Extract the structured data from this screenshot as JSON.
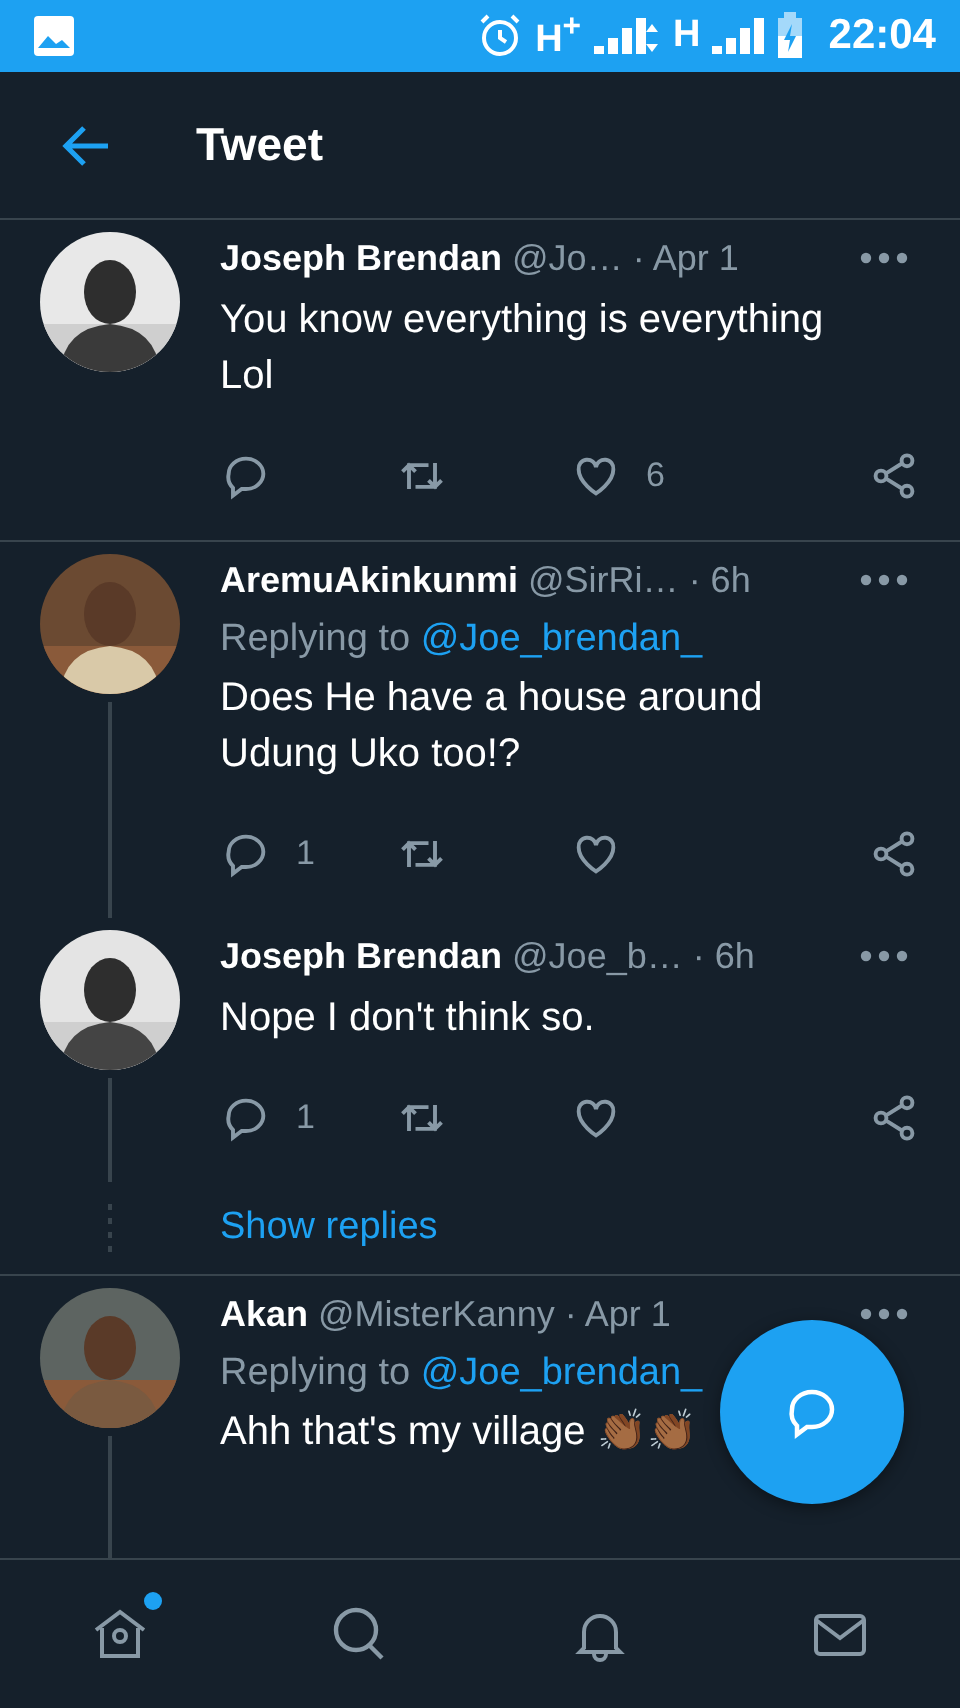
{
  "status_bar": {
    "network_1": "H$^{+}$",
    "network_2": "H",
    "time": "22:04"
  },
  "header": {
    "title": "Tweet"
  },
  "items": [
    {
      "kind": "tweet",
      "name": "Joseph Brendan",
      "handle": "@Jo…",
      "time": "· Apr 1",
      "text": "You know everything is everything Lol",
      "thread": false,
      "actions": true,
      "like_count": "6"
    },
    {
      "kind": "tweet",
      "name": "AremuAkinkunmi",
      "handle": "@SirRi…",
      "time": "· 6h",
      "replying_label": "Replying to",
      "replying_to": "@Joe_brendan_",
      "text": "Does He have a house around Udung Uko too!?",
      "thread": true,
      "actions": true,
      "reply_count": "1"
    },
    {
      "kind": "tweet",
      "name": "Joseph Brendan",
      "handle": "@Joe_b…",
      "time": "· 6h",
      "text": "Nope I don't think so.",
      "thread": true,
      "actions": true,
      "reply_count": "1"
    },
    {
      "kind": "show_replies",
      "label": "Show replies"
    },
    {
      "kind": "tweet",
      "name": "Akan",
      "handle": "@MisterKanny",
      "time": "· Apr 1",
      "replying_label": "Replying to",
      "replying_to": "@Joe_brendan_",
      "text": "Ahh that's my village 👏🏾👏🏾",
      "thread": true,
      "actions": false
    }
  ],
  "bottom_nav": [
    {
      "kind": "home",
      "badge": true
    },
    {
      "kind": "search",
      "badge": false
    },
    {
      "kind": "notifications",
      "badge": false
    },
    {
      "kind": "messages",
      "badge": false
    }
  ]
}
